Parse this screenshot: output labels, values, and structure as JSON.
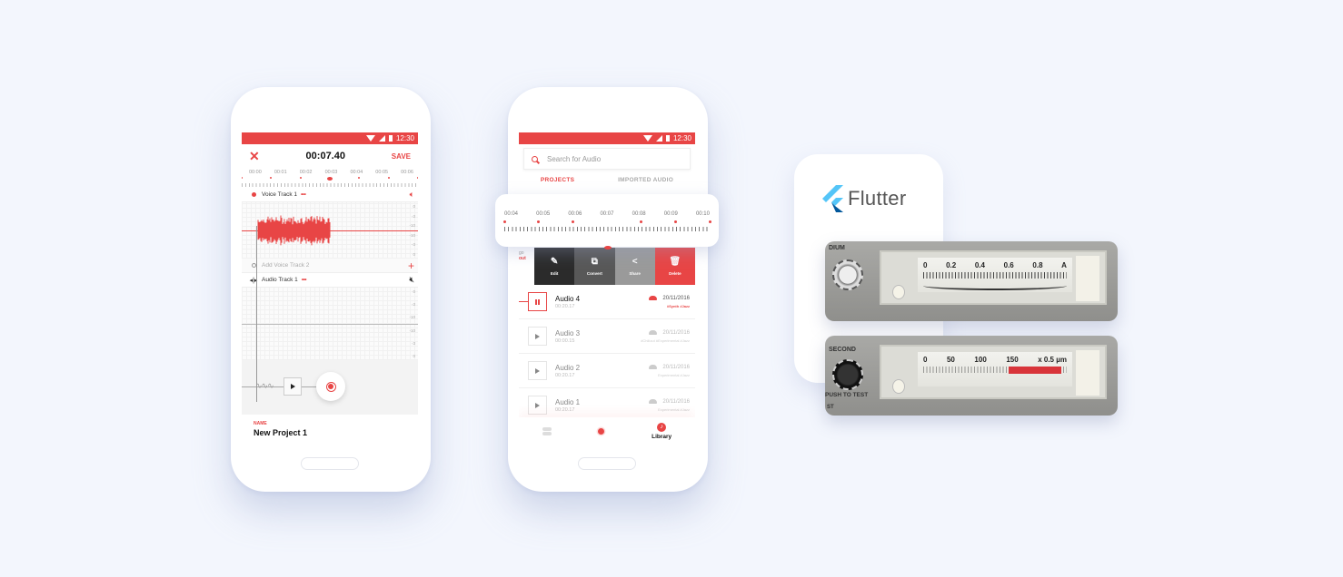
{
  "status_bar": {
    "time": "12:30"
  },
  "recorder": {
    "close_icon": "close-icon",
    "timer": "00:07.40",
    "save_label": "SAVE",
    "ruler_labels": [
      "00:00",
      "00:01",
      "00:02",
      "00:03",
      "00:04",
      "00:05",
      "00:06"
    ],
    "tracks": [
      {
        "name": "Voice Track 1",
        "menu": "•••",
        "icon": "speaker-icon",
        "db_scale": [
          "0",
          "-3",
          "-10",
          "-10",
          "-3",
          "0"
        ]
      },
      {
        "name": "Add Voice Track 2",
        "action": "+"
      },
      {
        "name": "Audio Track 1",
        "menu": "•••",
        "icon": "speaker-muted-icon",
        "db_scale": [
          "0",
          "-3",
          "-10",
          "-10",
          "-3",
          "0"
        ]
      }
    ],
    "name_label": "NAME",
    "name_value": "New Project 1"
  },
  "library": {
    "search_placeholder": "Search for Audio",
    "tabs": [
      "PROJECTS",
      "IMPORTED AUDIO"
    ],
    "zoom_ruler_labels": [
      "00:04",
      "00:05",
      "00:06",
      "00:07",
      "00:08",
      "00:09",
      "00:10"
    ],
    "peek_text": "go",
    "peek_tag": "out",
    "actions": [
      {
        "label": "Edit",
        "icon": "pencil-icon"
      },
      {
        "label": "Convert",
        "icon": "convert-icon"
      },
      {
        "label": "Share",
        "icon": "share-icon"
      },
      {
        "label": "Delete",
        "icon": "trash-icon"
      }
    ],
    "items": [
      {
        "title": "Audio 4",
        "duration": "00:20.17",
        "date": "20/11/2016",
        "tags": "#Synth #Jazz",
        "state": "playing"
      },
      {
        "title": "Audio 3",
        "duration": "00:00.15",
        "date": "20/11/2016",
        "tags": "#Chillout #Experimental #Jazz",
        "state": "idle"
      },
      {
        "title": "Audio 2",
        "duration": "00:20.17",
        "date": "20/11/2016",
        "tags": "Experimental #Jazz",
        "state": "idle"
      },
      {
        "title": "Audio 1",
        "duration": "00:20.17",
        "date": "20/11/2016",
        "tags": "Experimental #Jazz",
        "state": "idle"
      }
    ],
    "nav": [
      {
        "label": "",
        "icon": "toggle-icon"
      },
      {
        "label": "",
        "icon": "record-icon"
      },
      {
        "label": "Library",
        "icon": "music-note-icon"
      }
    ]
  },
  "flutter": {
    "wordmark": "Flutter",
    "meter1": {
      "label": "DIUM",
      "scale": [
        "0",
        "0.2",
        "0.4",
        "0.6",
        "0.8",
        "A"
      ]
    },
    "meter2": {
      "label_top": "SECOND",
      "label_bottom": "PUSH TO TEST",
      "label_corner": "ST",
      "scale": [
        "0",
        "50",
        "100",
        "150",
        "x 0.5 µm"
      ]
    }
  },
  "colors": {
    "accent": "#e84545",
    "background": "#f3f6fd",
    "flutter_light": "#54c5f8",
    "flutter_dark": "#01579b"
  }
}
